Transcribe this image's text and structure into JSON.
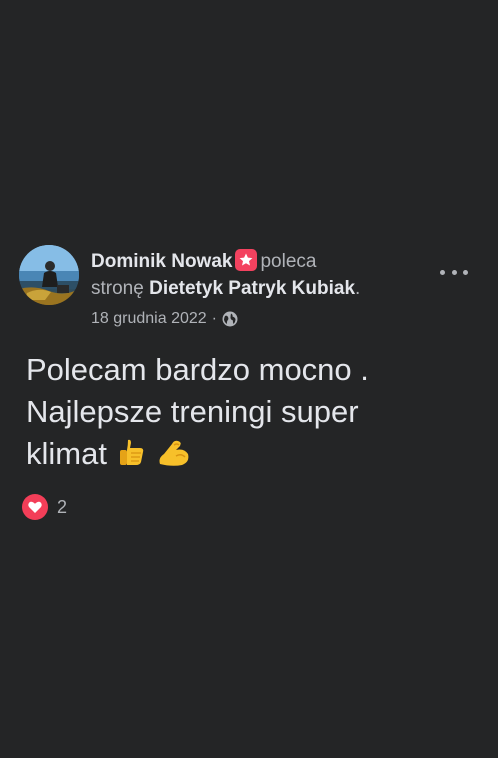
{
  "post": {
    "author": "Dominik Nowak",
    "action_word": "poleca",
    "line2_prefix": "stronę",
    "page_name": "Dietetyk Patryk Kubiak",
    "page_suffix": ".",
    "date": "18 grudnia 2022",
    "separator": "·",
    "audience_icon": "globe-icon",
    "badge_icon": "recommendation-star-icon",
    "more_icon": "more-options-icon",
    "text_line1": "Polecam bardzo mocno .",
    "text_line2": "Najlepsze treningi super",
    "text_line3": "klimat",
    "emojis": [
      "thumbs-up-emoji",
      "flexed-biceps-emoji"
    ]
  },
  "reactions": {
    "icon": "heart-icon",
    "count": "2"
  },
  "colors": {
    "background": "#242526",
    "primary_text": "#e4e6eb",
    "secondary_text": "#b0b3b8",
    "badge": "#f3425f",
    "heart": "#f33e58"
  }
}
